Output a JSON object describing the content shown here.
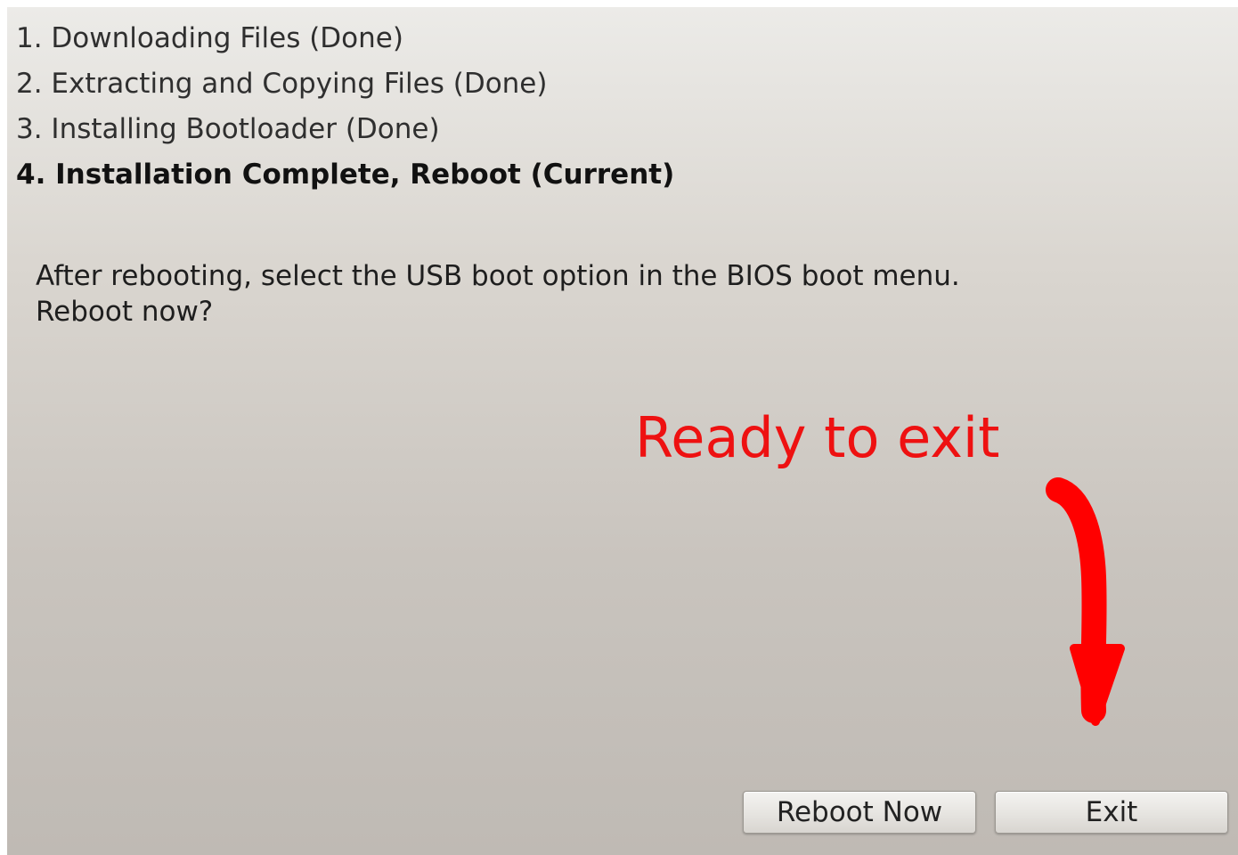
{
  "steps": [
    {
      "label": "1. Downloading Files (Done)",
      "state": "done"
    },
    {
      "label": "2. Extracting and Copying Files (Done)",
      "state": "done"
    },
    {
      "label": "3. Installing Bootloader (Done)",
      "state": "done"
    },
    {
      "label": "4. Installation Complete, Reboot (Current)",
      "state": "current"
    }
  ],
  "message": {
    "line1": "After rebooting, select the USB boot option in the BIOS boot menu.",
    "line2": "Reboot now?"
  },
  "annotation": {
    "text": "Ready to exit",
    "color": "#ee1111",
    "arrow_icon": "hand-drawn-down-arrow"
  },
  "buttons": {
    "reboot_label": "Reboot Now",
    "exit_label": "Exit"
  }
}
